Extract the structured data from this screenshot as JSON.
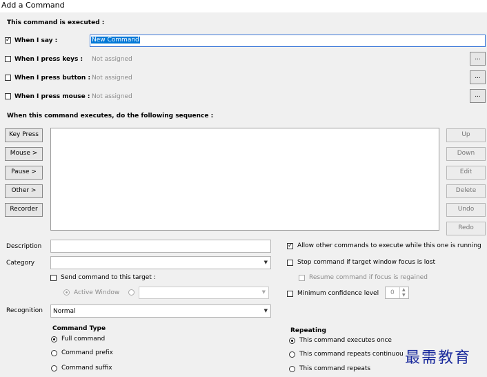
{
  "window": {
    "title": "Add a Command"
  },
  "trigger": {
    "heading": "This command is executed :",
    "say_label": "When I say :",
    "say_value": "New Command",
    "keys_label": "When I press keys :",
    "keys_value": "Not assigned",
    "button_label": "When I press button :",
    "button_value": "Not assigned",
    "mouse_label": "When I press mouse :",
    "mouse_value": "Not assigned",
    "ellipsis": "..."
  },
  "sequence": {
    "heading": "When this command executes, do the following sequence :",
    "left_buttons": [
      "Key Press",
      "Mouse >",
      "Pause >",
      "Other >",
      "Recorder"
    ],
    "right_buttons": [
      "Up",
      "Down",
      "Edit",
      "Delete",
      "Undo",
      "Redo"
    ]
  },
  "fields": {
    "description_label": "Description",
    "category_label": "Category",
    "send_target_label": "Send command to this target :",
    "active_window_label": "Active Window",
    "recognition_label": "Recognition",
    "recognition_value": "Normal"
  },
  "options": {
    "allow_label": "Allow other commands to execute while this one is running",
    "stop_label": "Stop command if target window focus is lost",
    "resume_label": "Resume command if focus is regained",
    "min_conf_label": "Minimum confidence level",
    "min_conf_value": "0"
  },
  "command_type": {
    "heading": "Command Type",
    "options": [
      "Full command",
      "Command prefix",
      "Command suffix"
    ]
  },
  "repeating": {
    "heading": "Repeating",
    "options": [
      "This command executes once",
      "This command repeats continuou",
      "This command repeats"
    ]
  },
  "watermark": {
    "text": "最需教育"
  }
}
